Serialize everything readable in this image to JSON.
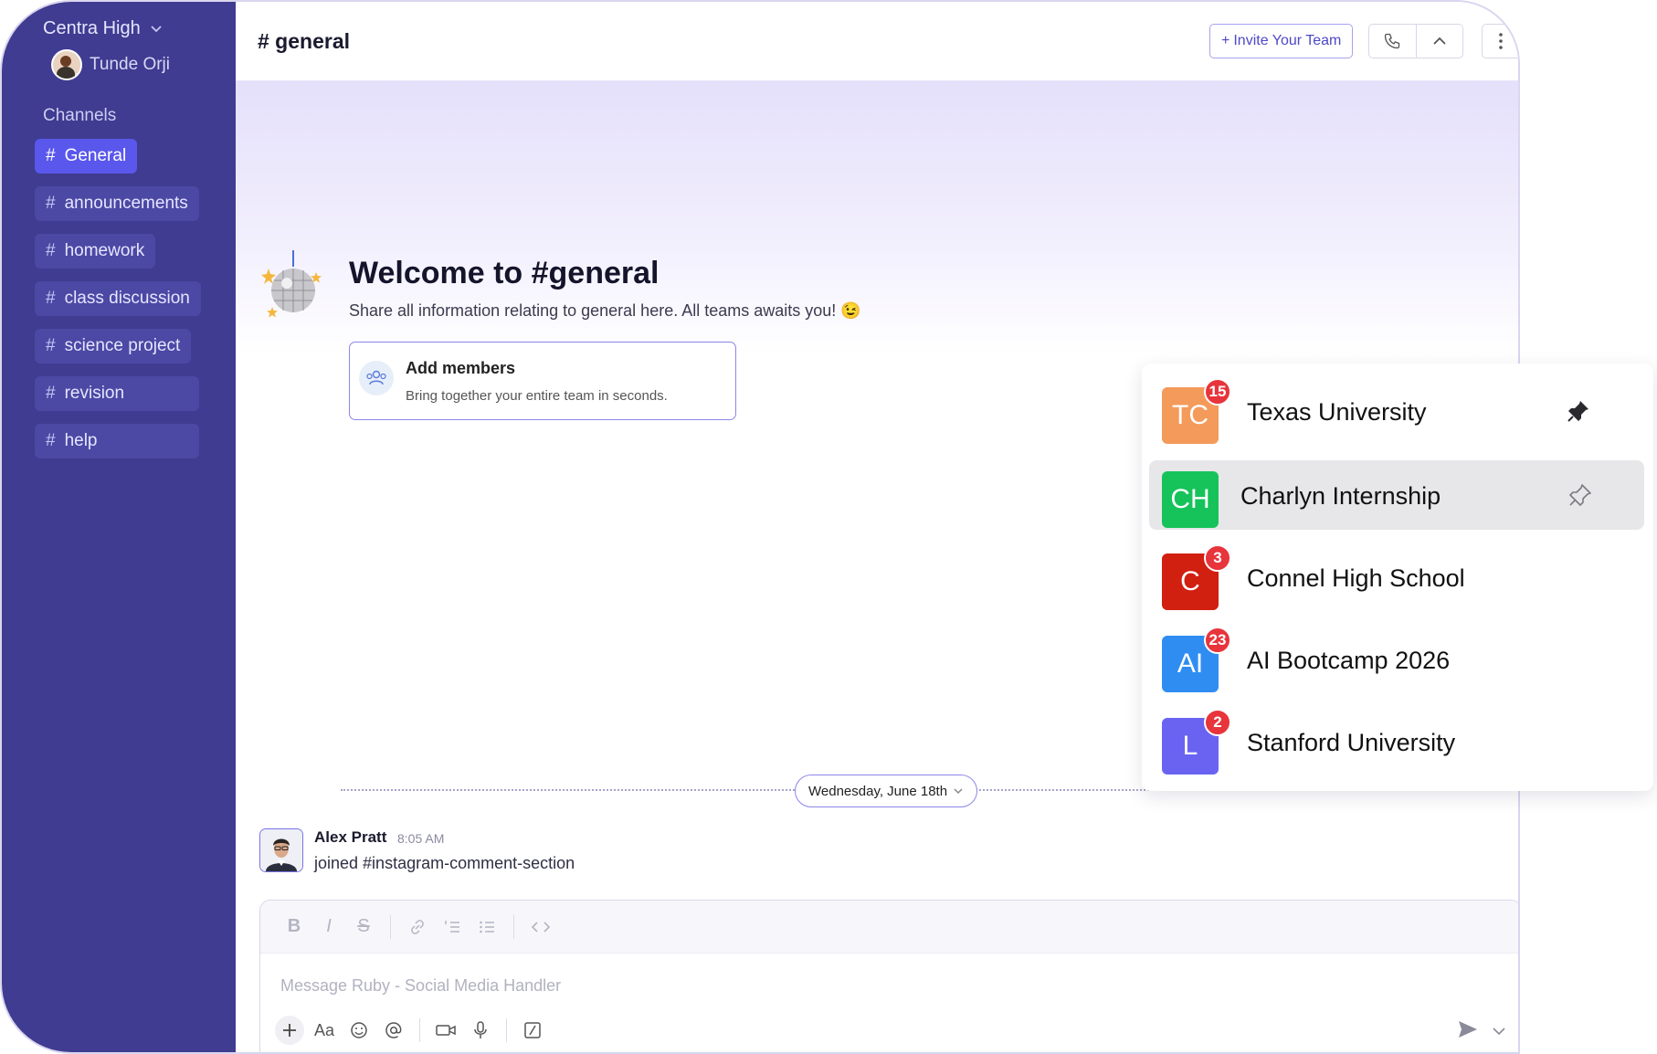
{
  "workspace": {
    "name": "Centra High",
    "user": "Tunde Orji"
  },
  "sidebar": {
    "section_label": "Channels",
    "channels": [
      {
        "hash": "#",
        "label": "General"
      },
      {
        "hash": "#",
        "label": "announcements"
      },
      {
        "hash": "#",
        "label": "homework"
      },
      {
        "hash": "#",
        "label": "class discussion"
      },
      {
        "hash": "#",
        "label": "science project"
      },
      {
        "hash": "#",
        "label": "revision"
      },
      {
        "hash": "#",
        "label": "help"
      }
    ]
  },
  "header": {
    "title": "# general",
    "invite_label": "Invite Your Team",
    "invite_plus": "+"
  },
  "welcome": {
    "title": "Welcome to #general",
    "subtitle": "Share all information relating to general here. All teams awaits you! 😉",
    "add_members_title": "Add members",
    "add_members_desc": "Bring together your entire team in seconds."
  },
  "date_divider": {
    "label": "Wednesday, June 18th"
  },
  "message": {
    "author": "Alex Pratt",
    "time": "8:05 AM",
    "text": "joined #instagram-comment-section"
  },
  "composer": {
    "placeholder": "Message Ruby - Social Media Handler",
    "font_label": "Aa"
  },
  "teams": [
    {
      "initials": "TC",
      "name": "Texas University",
      "badge": "15",
      "color": "#f49a5b",
      "pin": "filled"
    },
    {
      "initials": "CH",
      "name": "Charlyn Internship",
      "badge": "",
      "color": "#16c35a",
      "pin": "outline"
    },
    {
      "initials": "C",
      "name": "Connel High School",
      "badge": "3",
      "color": "#d11f10",
      "pin": ""
    },
    {
      "initials": "AI",
      "name": "AI Bootcamp 2026",
      "badge": "23",
      "color": "#2f8df2",
      "pin": ""
    },
    {
      "initials": "L",
      "name": "Stanford University",
      "badge": "2",
      "color": "#6a63f2",
      "pin": ""
    }
  ],
  "colors": {
    "sidebar": "#3f3c91",
    "accent": "#5a57ec",
    "badge": "#e8343b"
  }
}
